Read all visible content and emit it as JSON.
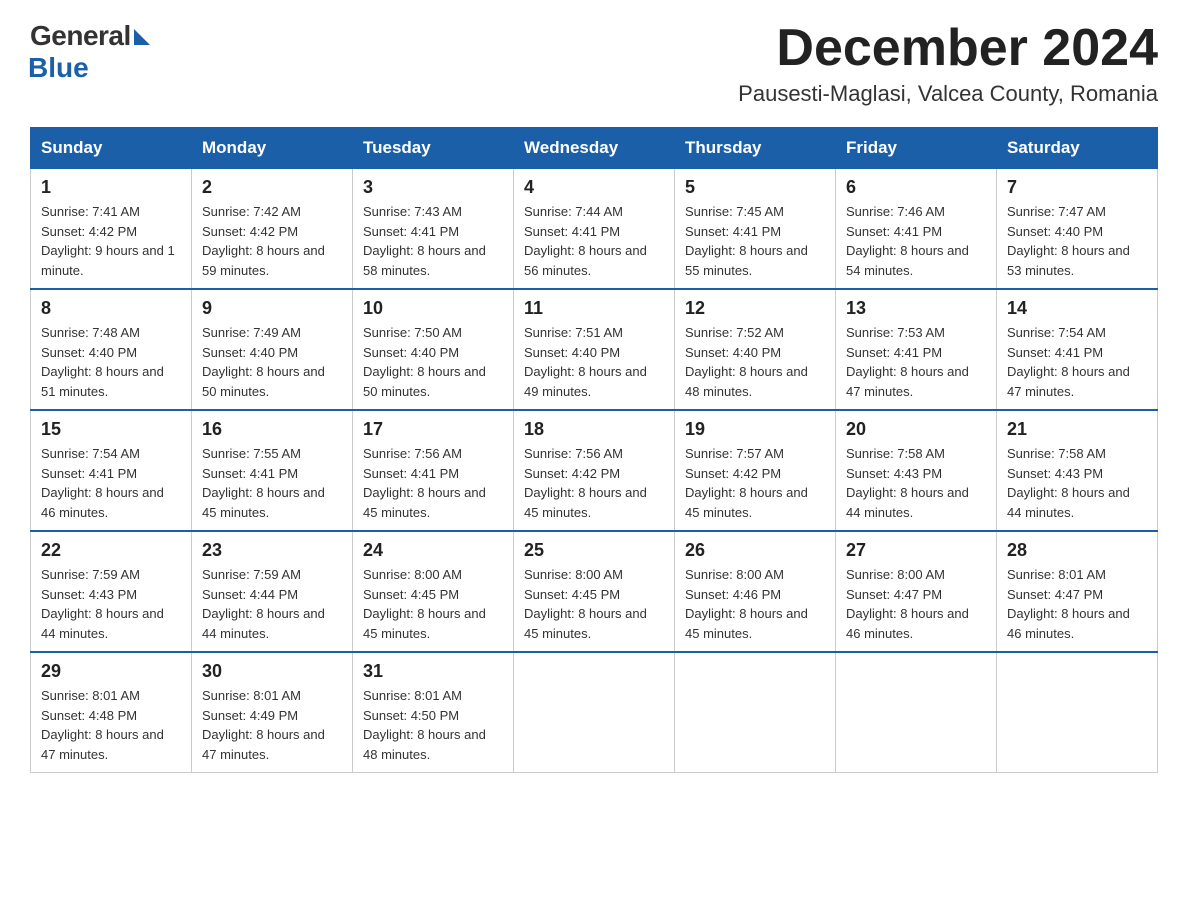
{
  "header": {
    "logo_general": "General",
    "logo_blue": "Blue",
    "month_title": "December 2024",
    "location": "Pausesti-Maglasi, Valcea County, Romania"
  },
  "days_of_week": [
    "Sunday",
    "Monday",
    "Tuesday",
    "Wednesday",
    "Thursday",
    "Friday",
    "Saturday"
  ],
  "weeks": [
    [
      {
        "day": "1",
        "sunrise": "7:41 AM",
        "sunset": "4:42 PM",
        "daylight": "9 hours and 1 minute."
      },
      {
        "day": "2",
        "sunrise": "7:42 AM",
        "sunset": "4:42 PM",
        "daylight": "8 hours and 59 minutes."
      },
      {
        "day": "3",
        "sunrise": "7:43 AM",
        "sunset": "4:41 PM",
        "daylight": "8 hours and 58 minutes."
      },
      {
        "day": "4",
        "sunrise": "7:44 AM",
        "sunset": "4:41 PM",
        "daylight": "8 hours and 56 minutes."
      },
      {
        "day": "5",
        "sunrise": "7:45 AM",
        "sunset": "4:41 PM",
        "daylight": "8 hours and 55 minutes."
      },
      {
        "day": "6",
        "sunrise": "7:46 AM",
        "sunset": "4:41 PM",
        "daylight": "8 hours and 54 minutes."
      },
      {
        "day": "7",
        "sunrise": "7:47 AM",
        "sunset": "4:40 PM",
        "daylight": "8 hours and 53 minutes."
      }
    ],
    [
      {
        "day": "8",
        "sunrise": "7:48 AM",
        "sunset": "4:40 PM",
        "daylight": "8 hours and 51 minutes."
      },
      {
        "day": "9",
        "sunrise": "7:49 AM",
        "sunset": "4:40 PM",
        "daylight": "8 hours and 50 minutes."
      },
      {
        "day": "10",
        "sunrise": "7:50 AM",
        "sunset": "4:40 PM",
        "daylight": "8 hours and 50 minutes."
      },
      {
        "day": "11",
        "sunrise": "7:51 AM",
        "sunset": "4:40 PM",
        "daylight": "8 hours and 49 minutes."
      },
      {
        "day": "12",
        "sunrise": "7:52 AM",
        "sunset": "4:40 PM",
        "daylight": "8 hours and 48 minutes."
      },
      {
        "day": "13",
        "sunrise": "7:53 AM",
        "sunset": "4:41 PM",
        "daylight": "8 hours and 47 minutes."
      },
      {
        "day": "14",
        "sunrise": "7:54 AM",
        "sunset": "4:41 PM",
        "daylight": "8 hours and 47 minutes."
      }
    ],
    [
      {
        "day": "15",
        "sunrise": "7:54 AM",
        "sunset": "4:41 PM",
        "daylight": "8 hours and 46 minutes."
      },
      {
        "day": "16",
        "sunrise": "7:55 AM",
        "sunset": "4:41 PM",
        "daylight": "8 hours and 45 minutes."
      },
      {
        "day": "17",
        "sunrise": "7:56 AM",
        "sunset": "4:41 PM",
        "daylight": "8 hours and 45 minutes."
      },
      {
        "day": "18",
        "sunrise": "7:56 AM",
        "sunset": "4:42 PM",
        "daylight": "8 hours and 45 minutes."
      },
      {
        "day": "19",
        "sunrise": "7:57 AM",
        "sunset": "4:42 PM",
        "daylight": "8 hours and 45 minutes."
      },
      {
        "day": "20",
        "sunrise": "7:58 AM",
        "sunset": "4:43 PM",
        "daylight": "8 hours and 44 minutes."
      },
      {
        "day": "21",
        "sunrise": "7:58 AM",
        "sunset": "4:43 PM",
        "daylight": "8 hours and 44 minutes."
      }
    ],
    [
      {
        "day": "22",
        "sunrise": "7:59 AM",
        "sunset": "4:43 PM",
        "daylight": "8 hours and 44 minutes."
      },
      {
        "day": "23",
        "sunrise": "7:59 AM",
        "sunset": "4:44 PM",
        "daylight": "8 hours and 44 minutes."
      },
      {
        "day": "24",
        "sunrise": "8:00 AM",
        "sunset": "4:45 PM",
        "daylight": "8 hours and 45 minutes."
      },
      {
        "day": "25",
        "sunrise": "8:00 AM",
        "sunset": "4:45 PM",
        "daylight": "8 hours and 45 minutes."
      },
      {
        "day": "26",
        "sunrise": "8:00 AM",
        "sunset": "4:46 PM",
        "daylight": "8 hours and 45 minutes."
      },
      {
        "day": "27",
        "sunrise": "8:00 AM",
        "sunset": "4:47 PM",
        "daylight": "8 hours and 46 minutes."
      },
      {
        "day": "28",
        "sunrise": "8:01 AM",
        "sunset": "4:47 PM",
        "daylight": "8 hours and 46 minutes."
      }
    ],
    [
      {
        "day": "29",
        "sunrise": "8:01 AM",
        "sunset": "4:48 PM",
        "daylight": "8 hours and 47 minutes."
      },
      {
        "day": "30",
        "sunrise": "8:01 AM",
        "sunset": "4:49 PM",
        "daylight": "8 hours and 47 minutes."
      },
      {
        "day": "31",
        "sunrise": "8:01 AM",
        "sunset": "4:50 PM",
        "daylight": "8 hours and 48 minutes."
      },
      null,
      null,
      null,
      null
    ]
  ]
}
